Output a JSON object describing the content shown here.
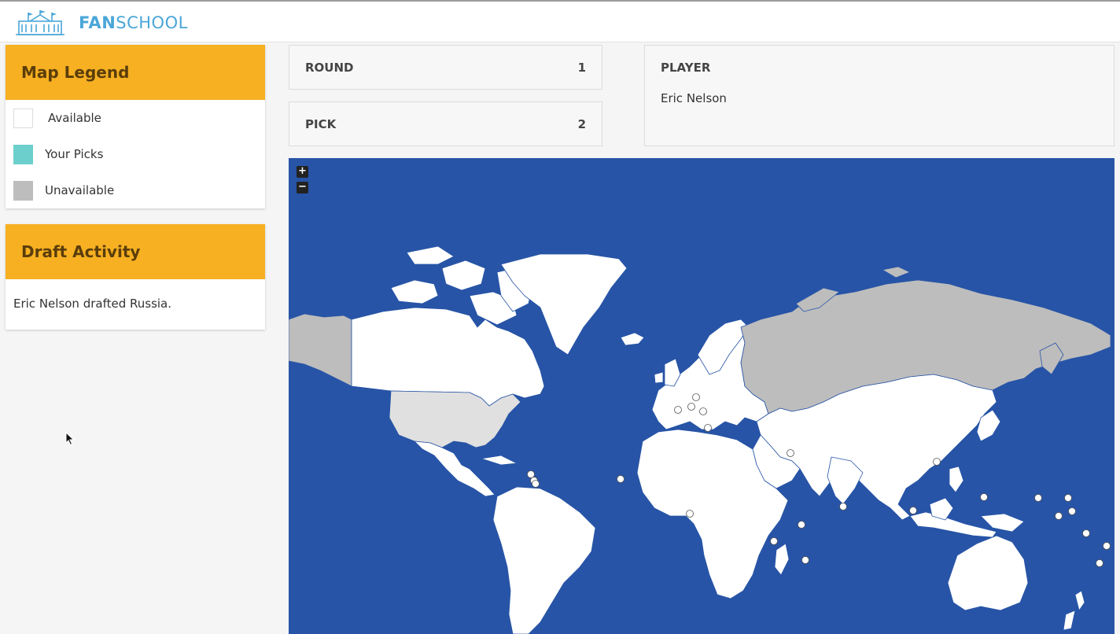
{
  "brand": {
    "fan": "FAN",
    "school": "SCHOOL"
  },
  "legend": {
    "title": "Map Legend",
    "items": [
      {
        "label": "Available",
        "color": "#ffffff"
      },
      {
        "label": "Your Picks",
        "color": "#6ccfcc"
      },
      {
        "label": "Unavailable",
        "color": "#bdbdbd"
      }
    ]
  },
  "activity": {
    "title": "Draft Activity",
    "entries": [
      "Eric Nelson drafted Russia."
    ]
  },
  "round": {
    "label": "ROUND",
    "value": "1"
  },
  "pick": {
    "label": "PICK",
    "value": "2"
  },
  "player": {
    "label": "PLAYER",
    "name": "Eric Nelson"
  },
  "map": {
    "zoom_in": "+",
    "zoom_out": "−",
    "ocean_color": "#2754a6",
    "land_color": "#ffffff",
    "unavailable_color": "#bdbdbd",
    "unavailable_countries": [
      "Russia",
      "Alaska (USA)"
    ],
    "light_grey_countries": [
      "United States"
    ]
  },
  "colors": {
    "accent": "#f6b021",
    "brand": "#4aa6d8"
  }
}
